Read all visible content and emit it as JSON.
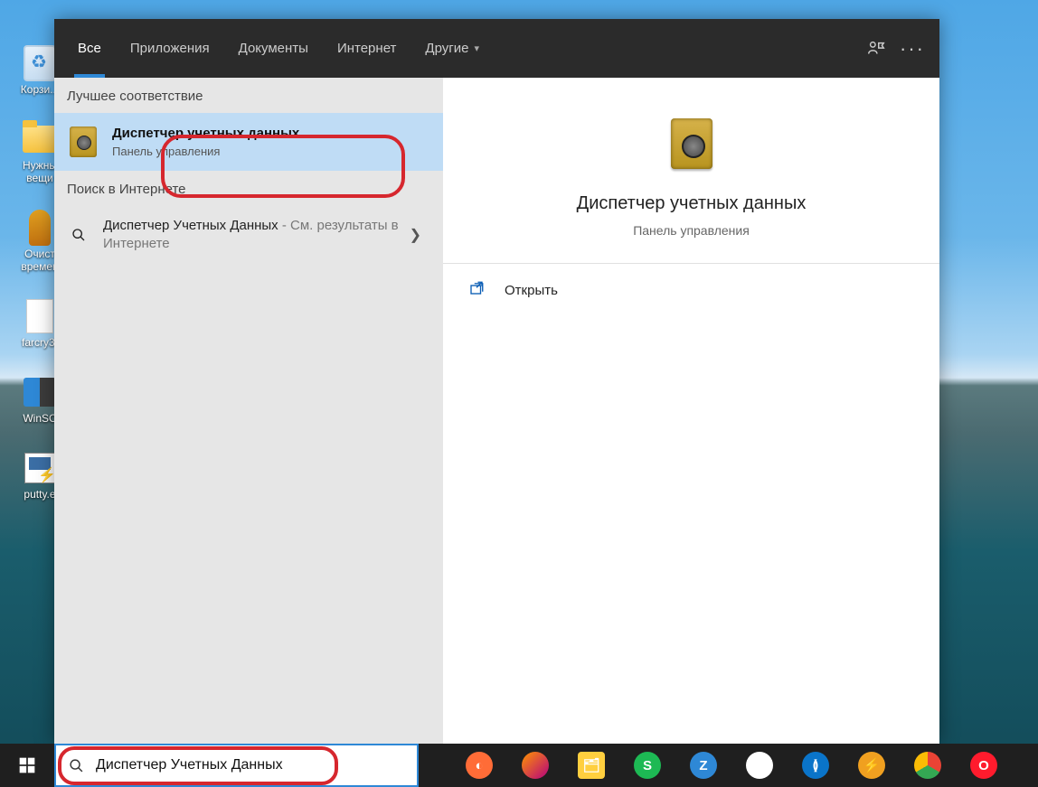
{
  "desktop_icons": [
    {
      "label": "Корзи..."
    },
    {
      "label": "Нужны\nвещи"
    },
    {
      "label": "Очист\nвремен"
    },
    {
      "label": "farcry3."
    },
    {
      "label": "WinSC"
    },
    {
      "label": "putty.e"
    }
  ],
  "search": {
    "tabs": {
      "all": "Все",
      "apps": "Приложения",
      "docs": "Документы",
      "web": "Интернет",
      "other": "Другие"
    },
    "sections": {
      "best": "Лучшее соответствие",
      "internet": "Поиск в Интернете"
    },
    "best_match": {
      "title": "Диспетчер учетных данных",
      "subtitle": "Панель управления"
    },
    "web_result": {
      "main": "Диспетчер Учетных Данных",
      "secondary": " - См. результаты в Интернете"
    },
    "preview": {
      "title": "Диспетчер учетных данных",
      "subtitle": "Панель управления",
      "action_open": "Открыть"
    },
    "input_value": "Диспетчер Учетных Данных"
  }
}
